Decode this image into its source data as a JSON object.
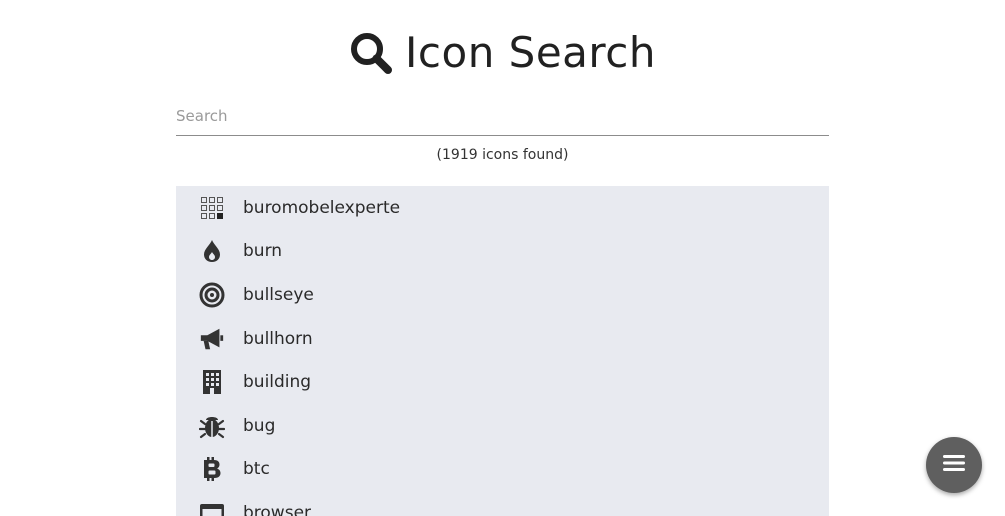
{
  "header": {
    "title": "Icon Search",
    "icon": "search-icon"
  },
  "search": {
    "placeholder": "Search",
    "value": ""
  },
  "results": {
    "count_text": "(1919 icons found)",
    "items": [
      {
        "label": "buromobelexperte",
        "icon": "buromobelexperte-icon"
      },
      {
        "label": "burn",
        "icon": "burn-icon"
      },
      {
        "label": "bullseye",
        "icon": "bullseye-icon"
      },
      {
        "label": "bullhorn",
        "icon": "bullhorn-icon"
      },
      {
        "label": "building",
        "icon": "building-icon"
      },
      {
        "label": "bug",
        "icon": "bug-icon"
      },
      {
        "label": "btc",
        "icon": "btc-icon"
      },
      {
        "label": "browser",
        "icon": "browser-icon"
      }
    ]
  },
  "fab": {
    "icon": "menu-icon"
  },
  "colors": {
    "list_background": "#e8eaf0",
    "fab_background": "#5f5f5f",
    "text": "#212121"
  }
}
